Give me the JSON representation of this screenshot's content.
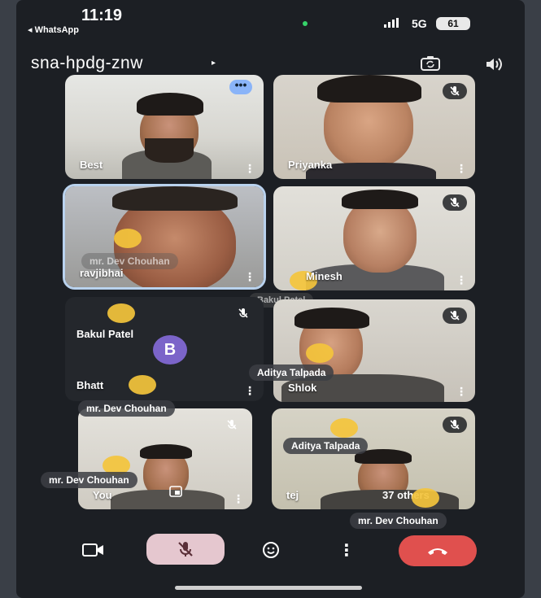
{
  "status": {
    "time": "11:19",
    "back_app": "◂ WhatsApp",
    "network": "5G",
    "battery": "61"
  },
  "meeting": {
    "code": "sna-hpdg-znw",
    "chevron": "▸",
    "icons": [
      "camera-flip-icon",
      "speaker-icon"
    ]
  },
  "tiles": {
    "best": {
      "name": "Best"
    },
    "priyanka": {
      "name": "Priyanka"
    },
    "ravjibhai": {
      "name": "ravjibhai",
      "overlay": "mr. Dev Chouhan"
    },
    "minesh": {
      "name": "Minesh",
      "overlay": "Bakul Patel"
    },
    "bhatt": {
      "name": "Bhatt",
      "sticker": "Bakul Patel",
      "avatar_letter": "B"
    },
    "shlok": {
      "name": "Shlok",
      "sticker": "Aditya Talpada"
    },
    "you": {
      "name": "You",
      "sticker": "mr. Dev Chouhan",
      "sticker2": "mr. Dev Chouhan"
    },
    "tej": {
      "name": "tej",
      "sticker": "Aditya Talpada",
      "others": "37 others",
      "sticker2": "mr. Dev Chouhan"
    }
  },
  "controls": [
    "video-icon",
    "mic-off-icon",
    "emoji-icon",
    "more-icon",
    "end-call-icon"
  ],
  "colors": {
    "background": "#1c1f24",
    "end_call": "#e0504e",
    "mic_pill": "#e5c7cf",
    "active_outline": "#b9d2ee",
    "avatar": "#7b64c9"
  }
}
